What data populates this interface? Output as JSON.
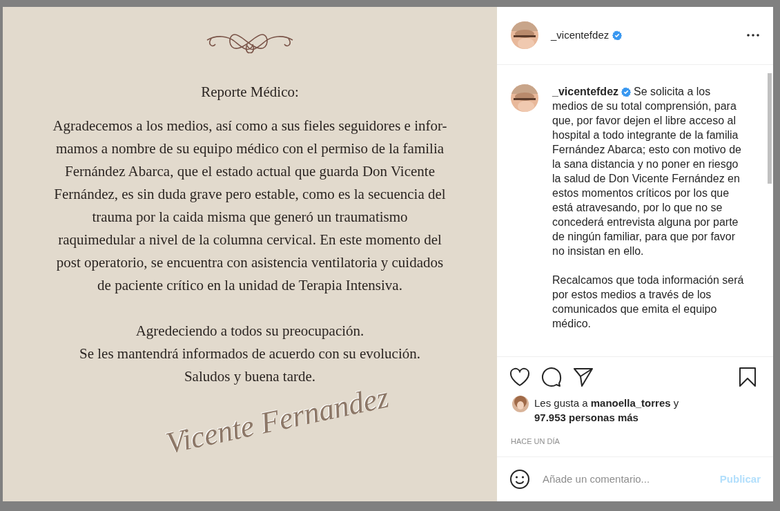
{
  "post_image": {
    "title": "Reporte Médico:",
    "body_lines": [
      "Agradecemos a los medios, así como a sus fieles seguidores e infor-",
      "mamos a nombre de su equipo médico con el permiso de la familia",
      "Fernández Abarca, que el estado actual que guarda Don Vicente",
      "Fernández, es sin duda grave pero estable, como es la secuencia del",
      "trauma por la caida misma que generó un traumatismo",
      "raquimedular a nivel de la columna cervical. En este momento del",
      "post operatorio, se encuentra con asistencia ventilatoria y cuidados",
      "de paciente crítico en la unidad de Terapia Intensiva."
    ],
    "closing_lines": [
      "Agredeciendo a todos su preocupación.",
      "Se les mantendrá informados de acuerdo con su evolución.",
      "Saludos y buena tarde."
    ],
    "signature": "Vicente Fernandez"
  },
  "header": {
    "username": "_vicentefdez",
    "verified": true
  },
  "caption": {
    "username": "_vicentefdez",
    "verified": true,
    "paragraphs": [
      "Se solicita a los medios de su total comprensión, para que, por favor dejen el libre acceso al hospital a todo integrante de la familia Fernández Abarca; esto con motivo de la sana distancia y no poner en riesgo la salud de Don Vicente Fernández en estos momentos críticos por los que está atravesando, por lo que no se concederá entrevista alguna por parte de ningún familiar, para que por favor no insistan en ello.",
      "Recalcamos que toda información será por estos medios a través de los comunicados que emita el equipo médico."
    ]
  },
  "actions": {
    "liked": false,
    "saved": false
  },
  "likes": "Les gusta a **manoella_torres** y **97.953 personas más**",
  "timestamp": "HACE UN DÍA",
  "comment": {
    "placeholder": "Añade un comentario...",
    "button": "Publicar"
  }
}
